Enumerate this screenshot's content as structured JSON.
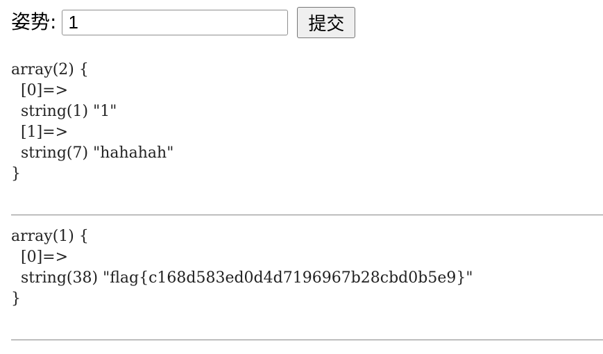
{
  "form": {
    "label": "姿势:",
    "input_value": "1",
    "submit_label": "提交"
  },
  "dumps": [
    {
      "header": "array(2) {",
      "entries": [
        {
          "key": "  [0]=>",
          "value": "  string(1) \"1\""
        },
        {
          "key": "  [1]=>",
          "value": "  string(7) \"hahahah\""
        }
      ],
      "footer": "}"
    },
    {
      "header": "array(1) {",
      "entries": [
        {
          "key": "  [0]=>",
          "value": "  string(38) \"flag{c168d583ed0d4d7196967b28cbd0b5e9}\""
        }
      ],
      "footer": "}"
    }
  ]
}
